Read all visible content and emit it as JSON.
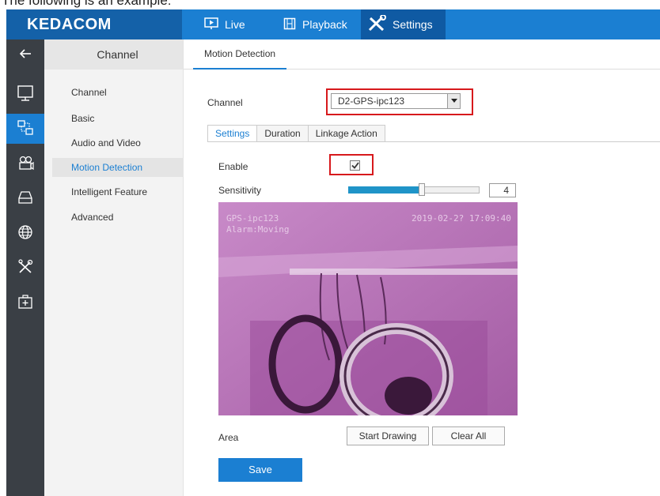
{
  "caption": "The following is an example:",
  "topbar": {
    "logo": "KEDACOM",
    "nav": [
      {
        "label": "Live",
        "icon": "play-icon"
      },
      {
        "label": "Playback",
        "icon": "film-icon"
      },
      {
        "label": "Settings",
        "icon": "tools-icon"
      }
    ]
  },
  "iconbar": {
    "items": [
      "back-arrow-icon",
      "monitor-icon",
      "network-icon",
      "camera-icon",
      "storage-icon",
      "globe-icon",
      "tools-icon",
      "first-aid-icon"
    ],
    "active_index": 2
  },
  "sidebar": {
    "header": "Channel",
    "items": [
      {
        "label": "Channel"
      },
      {
        "label": "Basic"
      },
      {
        "label": "Audio and Video"
      },
      {
        "label": "Motion Detection"
      },
      {
        "label": "Intelligent Feature"
      },
      {
        "label": "Advanced"
      }
    ],
    "active_index": 3
  },
  "main": {
    "tab": "Motion Detection",
    "channel_label": "Channel",
    "channel_value": "D2-GPS-ipc123",
    "subtabs": [
      "Settings",
      "Duration",
      "Linkage Action"
    ],
    "enable_label": "Enable",
    "enable_checked": true,
    "sensitivity_label": "Sensitivity",
    "sensitivity_value": "4",
    "sensitivity_fraction": 0.55,
    "video": {
      "osd_camera": "GPS-ipc123",
      "osd_alarm": "Alarm:Moving",
      "osd_time": "2019-02-2? 17:09:40"
    },
    "area_label": "Area",
    "start_drawing": "Start Drawing",
    "clear_all": "Clear All",
    "save": "Save"
  },
  "colors": {
    "accent": "#1b7fd2",
    "logo_bg": "#1461a8",
    "iconbar_bg": "#3a3f45",
    "highlight_red": "#d7191c",
    "video_tint": "#b66fb6"
  }
}
